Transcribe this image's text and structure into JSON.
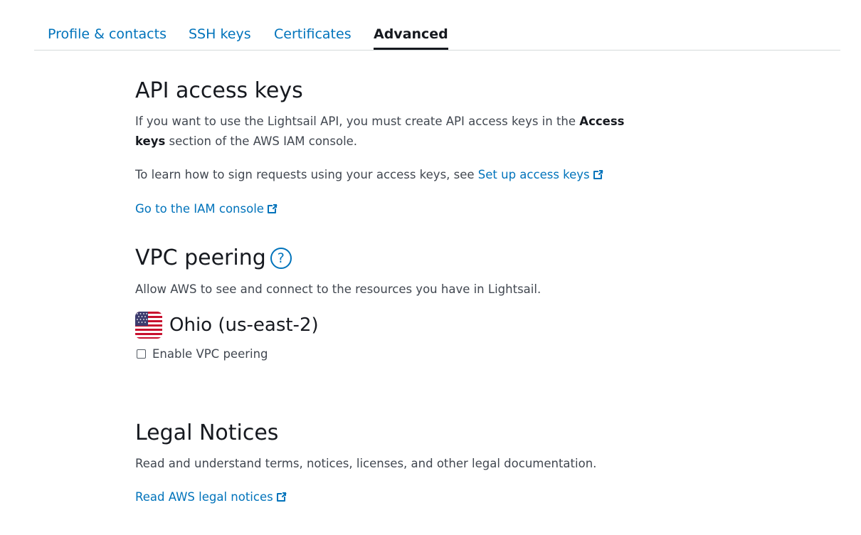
{
  "tabs": [
    {
      "label": "Profile & contacts",
      "active": false
    },
    {
      "label": "SSH keys",
      "active": false
    },
    {
      "label": "Certificates",
      "active": false
    },
    {
      "label": "Advanced",
      "active": true
    }
  ],
  "api_keys": {
    "title": "API access keys",
    "desc_part1": "If you want to use the Lightsail API, you must create API access keys in the ",
    "desc_bold1": "Access",
    "desc_bold2": "keys",
    "desc_part2": " section of the AWS IAM console.",
    "learn_text": "To learn how to sign requests using your access keys, see ",
    "learn_link": "Set up access keys",
    "console_link": "Go to the IAM console"
  },
  "vpc": {
    "title": "VPC peering",
    "help_icon": "?",
    "desc": "Allow AWS to see and connect to the resources you have in Lightsail.",
    "region": "Ohio (us-east-2)",
    "region_flag_icon": "us-flag-icon",
    "checkbox_label": "Enable VPC peering",
    "checkbox_checked": false
  },
  "legal": {
    "title": "Legal Notices",
    "desc": "Read and understand terms, notices, licenses, and other legal documentation.",
    "link": "Read AWS legal notices"
  },
  "colors": {
    "link": "#0073bb",
    "heading": "#16191f",
    "body_text": "#414750",
    "divider": "#d5dbdb"
  }
}
